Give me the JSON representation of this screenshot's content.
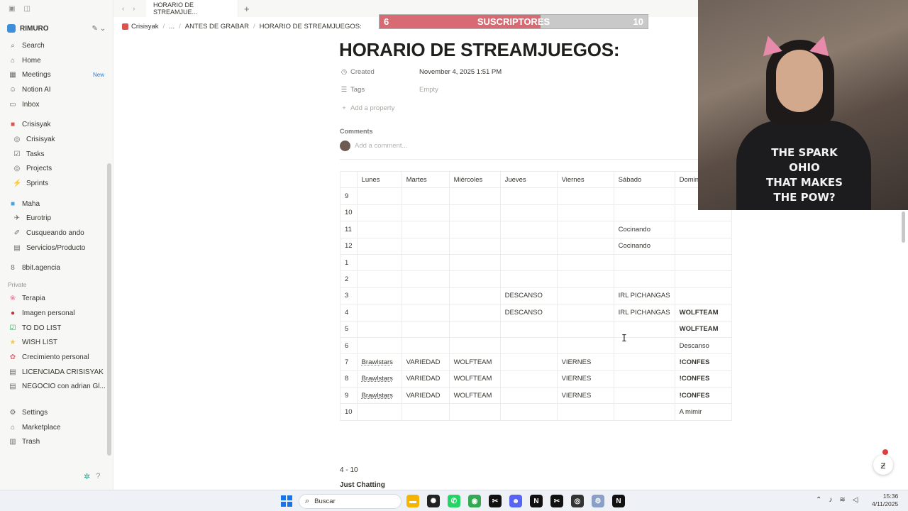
{
  "sidebar": {
    "workspace": "RIMURO",
    "main_nav": [
      {
        "icon": "search-icon",
        "glyph": "⌕",
        "label": "Search"
      },
      {
        "icon": "home-icon",
        "glyph": "⌂",
        "label": "Home"
      },
      {
        "icon": "calendar-icon",
        "glyph": "▦",
        "label": "Meetings",
        "badge": "New"
      },
      {
        "icon": "notion-ai-icon",
        "glyph": "☺",
        "label": "Notion AI"
      },
      {
        "icon": "inbox-icon",
        "glyph": "▭",
        "label": "Inbox"
      }
    ],
    "teamspace_1": {
      "label": "Crisisyak",
      "items": [
        "Crisisyak",
        "Tasks",
        "Projects",
        "Sprints"
      ]
    },
    "teamspace_2": {
      "label": "Maha",
      "items": [
        "Eurotrip",
        "Cusqueando ando",
        "Servicios/Producto"
      ]
    },
    "teamspace_3": {
      "label": "8bit.agencia"
    },
    "private_label": "Private",
    "private_items": [
      {
        "icon": "brain-icon",
        "label": "Terapia"
      },
      {
        "icon": "pin-icon",
        "label": "Imagen personal"
      },
      {
        "icon": "checkbox-icon",
        "label": "TO DO LIST"
      },
      {
        "icon": "star-icon",
        "label": "WISH LIST"
      },
      {
        "icon": "flower-icon",
        "label": "Crecimiento personal"
      },
      {
        "icon": "page-icon",
        "label": "LICENCIADA CRISISYAK"
      },
      {
        "icon": "page-icon",
        "label": "NEGOCIO con adrian Gl..."
      }
    ],
    "bottom_nav": [
      "Settings",
      "Marketplace",
      "Trash"
    ]
  },
  "tab": {
    "title": "HORARIO DE STREAMJUE..."
  },
  "breadcrumb": [
    "Crisisyak",
    "...",
    "ANTES DE GRABAR",
    "HORARIO DE STREAMJUEGOS:"
  ],
  "sub_goal": {
    "current": "6",
    "label": "SUSCRIPTORES",
    "target": "10",
    "progress": 0.6
  },
  "page": {
    "title": "HORARIO DE STREAMJUEGOS:",
    "created_label": "Created",
    "created_value": "November 4, 2025 1:51 PM",
    "tags_label": "Tags",
    "tags_value": "Empty",
    "add_property": "Add a property",
    "comments_label": "Comments",
    "comment_placeholder": "Add a comment..."
  },
  "schedule": {
    "headers": [
      "",
      "Lunes",
      "Martes",
      "Miércoles",
      "Jueves",
      "Viernes",
      "Sábado",
      "Domingo"
    ],
    "rows": [
      [
        "9",
        "",
        "",
        "",
        "",
        "",
        "",
        ""
      ],
      [
        "10",
        "",
        "",
        "",
        "",
        "",
        "",
        ""
      ],
      [
        "11",
        "",
        "",
        "",
        "",
        "",
        "Cocinando",
        ""
      ],
      [
        "12",
        "",
        "",
        "",
        "",
        "",
        "Cocinando",
        ""
      ],
      [
        "1",
        "",
        "",
        "",
        "",
        "",
        "",
        ""
      ],
      [
        "2",
        "",
        "",
        "",
        "",
        "",
        "",
        ""
      ],
      [
        "3",
        "",
        "",
        "",
        "DESCANSO",
        "",
        "IRL PICHANGAS",
        ""
      ],
      [
        "4",
        "",
        "",
        "",
        "DESCANSO",
        "",
        "IRL PICHANGAS",
        "WOLFTEAM"
      ],
      [
        "5",
        "",
        "",
        "",
        "",
        "",
        "",
        "WOLFTEAM"
      ],
      [
        "6",
        "",
        "",
        "",
        "",
        "",
        "",
        "Descanso"
      ],
      [
        "7",
        "Brawlstars",
        "VARIEDAD",
        "WOLFTEAM",
        "",
        "VIERNES",
        "",
        "!CONFES"
      ],
      [
        "8",
        "Brawlstars",
        "VARIEDAD",
        "WOLFTEAM",
        "",
        "VIERNES",
        "",
        "!CONFES"
      ],
      [
        "9",
        "Brawlstars",
        "VARIEDAD",
        "WOLFTEAM",
        "",
        "VIERNES",
        "",
        "!CONFES"
      ],
      [
        "10",
        "",
        "",
        "",
        "",
        "",
        "",
        "A mimir"
      ]
    ]
  },
  "below": {
    "range": "4 - 10",
    "heading": "Just Chatting"
  },
  "webcam": {
    "shirt_lines": [
      "THE SPARK",
      "OHIO",
      "THAT MAKES",
      "THE POW?"
    ]
  },
  "taskbar": {
    "search_placeholder": "Buscar",
    "time": "15:36",
    "date": "4/11/2025"
  }
}
